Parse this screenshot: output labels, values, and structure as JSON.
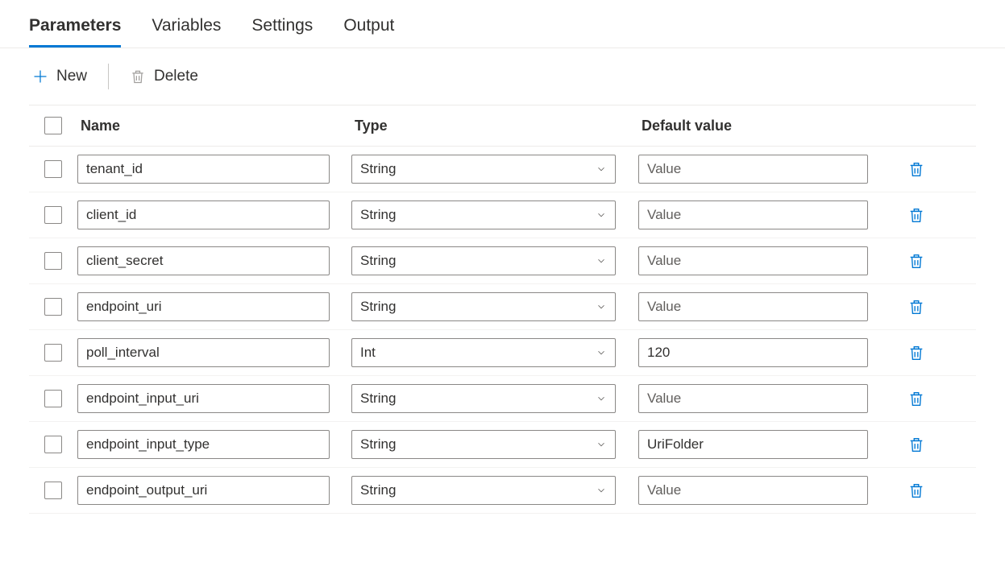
{
  "tabs": [
    {
      "label": "Parameters",
      "active": true
    },
    {
      "label": "Variables",
      "active": false
    },
    {
      "label": "Settings",
      "active": false
    },
    {
      "label": "Output",
      "active": false
    }
  ],
  "toolbar": {
    "new_label": "New",
    "delete_label": "Delete"
  },
  "columns": {
    "name": "Name",
    "type": "Type",
    "default_value": "Default value"
  },
  "value_placeholder": "Value",
  "rows": [
    {
      "name": "tenant_id",
      "type": "String",
      "default_value": ""
    },
    {
      "name": "client_id",
      "type": "String",
      "default_value": ""
    },
    {
      "name": "client_secret",
      "type": "String",
      "default_value": ""
    },
    {
      "name": "endpoint_uri",
      "type": "String",
      "default_value": ""
    },
    {
      "name": "poll_interval",
      "type": "Int",
      "default_value": "120"
    },
    {
      "name": "endpoint_input_uri",
      "type": "String",
      "default_value": ""
    },
    {
      "name": "endpoint_input_type",
      "type": "String",
      "default_value": "UriFolder"
    },
    {
      "name": "endpoint_output_uri",
      "type": "String",
      "default_value": ""
    }
  ]
}
